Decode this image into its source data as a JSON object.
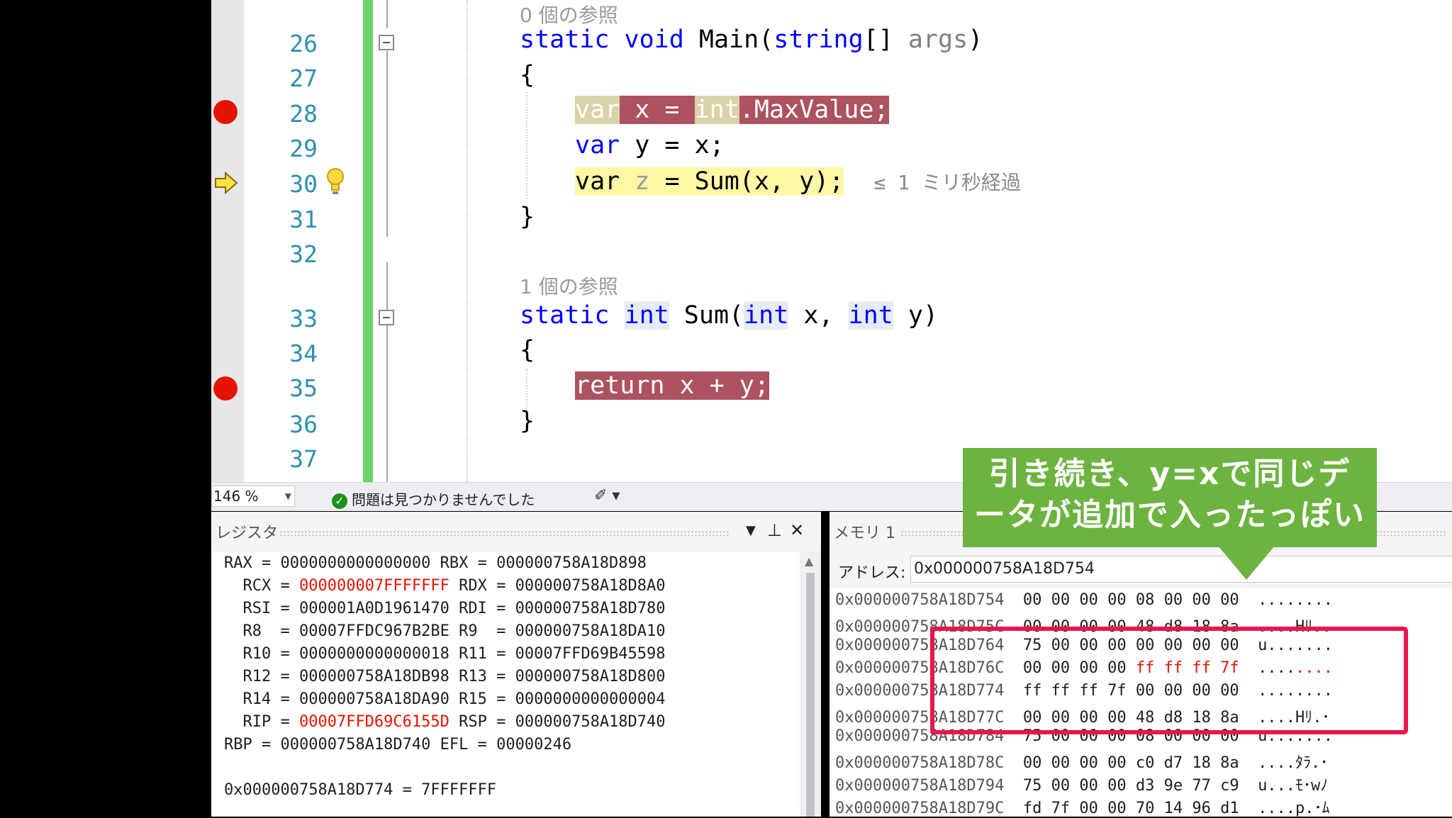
{
  "code_editor": {
    "lines": [
      {
        "num": "26",
        "text": "static void Main(string[] args)"
      },
      {
        "num": "27",
        "text": "{"
      },
      {
        "num": "28",
        "text": "var x = int.MaxValue;"
      },
      {
        "num": "29",
        "text": "var y = x;"
      },
      {
        "num": "30",
        "text": "var z = Sum(x, y);"
      },
      {
        "num": "31",
        "text": "}"
      },
      {
        "num": "32",
        "text": ""
      },
      {
        "num": "33",
        "text": "static int Sum(int x, int y)"
      },
      {
        "num": "34",
        "text": "{"
      },
      {
        "num": "35",
        "text": "return x + y;"
      },
      {
        "num": "36",
        "text": "}"
      },
      {
        "num": "37",
        "text": ""
      }
    ],
    "hint_main": "0 個の参照",
    "hint_sum": "1 個の参照",
    "elapsed": "≤ 1 ミリ秒経過",
    "breakpoint_lines": [
      "28",
      "35"
    ],
    "current_line": "30"
  },
  "status_bar": {
    "zoom": "146 %",
    "issues": "問題は見つかりませんでした"
  },
  "registers_panel": {
    "title": "レジスタ",
    "lines": [
      {
        "text": "RAX = 0000000000000000 RBX = 000000758A18D898"
      },
      {
        "pre": "  RCX = ",
        "red": "000000007FFFFFFF",
        "post": " RDX = 000000758A18D8A0"
      },
      {
        "text": "  RSI = 000001A0D1961470 RDI = 000000758A18D780"
      },
      {
        "text": "  R8  = 00007FFDC967B2BE R9  = 000000758A18DA10"
      },
      {
        "text": "  R10 = 0000000000000018 R11 = 00007FFD69B45598"
      },
      {
        "text": "  R12 = 000000758A18DB98 R13 = 000000758A18D800"
      },
      {
        "text": "  R14 = 000000758A18DA90 R15 = 0000000000000004"
      },
      {
        "pre": "  RIP = ",
        "red": "00007FFD69C6155D",
        "post": " RSP = 000000758A18D740"
      },
      {
        "text": "RBP = 000000758A18D740 EFL = 00000246"
      },
      {
        "text": ""
      },
      {
        "text": "0x000000758A18D774 = 7FFFFFFF"
      }
    ]
  },
  "memory_panel": {
    "title": "メモリ 1",
    "address_label": "アドレス:",
    "address_value": "0x000000758A18D754",
    "rows": [
      {
        "addr": "0x000000758A18D754",
        "bytes": "00 00 00 00 08 00 00 00",
        "chars": "........"
      },
      {
        "addr": "0x000000758A18D75C",
        "bytes": "00 00 00 00 48 d8 18 8a",
        "chars": "....Hﾘ.."
      },
      {
        "addr": "0x000000758A18D764",
        "bytes": "75 00 00 00 00 00 00 00",
        "chars": "u......."
      },
      {
        "addr": "0x000000758A18D76C",
        "bytes_pre": "00 00 00 00 ",
        "bytes_red": "ff ff ff 7f",
        "chars_pre": "....",
        "chars_red": "...."
      },
      {
        "addr": "0x000000758A18D774",
        "bytes": "ff ff ff 7f 00 00 00 00",
        "chars": "........"
      },
      {
        "addr": "0x000000758A18D77C",
        "bytes": "00 00 00 00 48 d8 18 8a",
        "chars": "....Hﾘ.･"
      },
      {
        "addr": "0x000000758A18D784",
        "bytes": "75 00 00 00 08 00 00 00",
        "chars": "u......."
      },
      {
        "addr": "0x000000758A18D78C",
        "bytes": "00 00 00 00 c0 d7 18 8a",
        "chars": "....ﾀﾗ.･"
      },
      {
        "addr": "0x000000758A18D794",
        "bytes": "75 00 00 00 d3 9e 77 c9",
        "chars": "u...ﾓ･wﾉ"
      },
      {
        "addr": "0x000000758A18D79C",
        "bytes": "fd 7f 00 00 70 14 96 d1",
        "chars": "....p.･ﾑ"
      }
    ]
  },
  "annotation": {
    "line1": "引き続き、y=xで同じデ",
    "line2": "ータが追加で入ったっぽい"
  },
  "colors": {
    "breakpoint": "#e51400",
    "breakpoint_highlight": "#ac5261",
    "current_line_highlight": "#fff7a6",
    "keyword": "#0000ff",
    "line_number": "#2b91af",
    "callout": "#6db33f",
    "highlight_box": "#e8174a"
  }
}
